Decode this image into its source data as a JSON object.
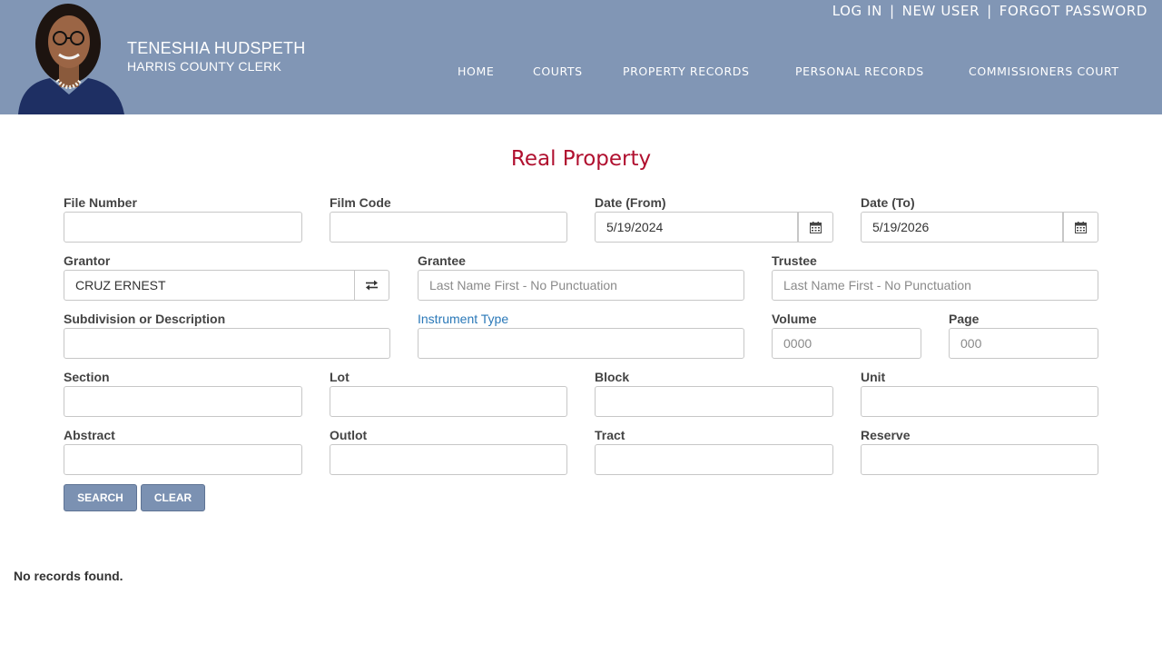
{
  "header": {
    "clerk_name": "TENESHIA HUDSPETH",
    "clerk_title": "HARRIS COUNTY CLERK",
    "top_links": [
      "LOG IN",
      "NEW USER",
      "FORGOT PASSWORD"
    ],
    "separator": "|",
    "nav": [
      "HOME",
      "COURTS",
      "PROPERTY RECORDS",
      "PERSONAL RECORDS",
      "COMMISSIONERS COURT"
    ],
    "colors": {
      "header_bg": "#8196b5",
      "title": "#b0102f",
      "button": "#7b91b2",
      "link_label": "#2a78b8"
    }
  },
  "page_title": "Real Property",
  "form": {
    "file_number": {
      "label": "File Number",
      "value": "",
      "placeholder": ""
    },
    "film_code": {
      "label": "Film Code",
      "value": "",
      "placeholder": ""
    },
    "date_from": {
      "label": "Date (From)",
      "value": "5/19/2024",
      "icon": "calendar-icon"
    },
    "date_to": {
      "label": "Date (To)",
      "value": "5/19/2026",
      "icon": "calendar-icon"
    },
    "grantor": {
      "label": "Grantor",
      "value": "CRUZ ERNEST",
      "icon": "swap-icon"
    },
    "grantee": {
      "label": "Grantee",
      "value": "",
      "placeholder": "Last Name First - No Punctuation"
    },
    "trustee": {
      "label": "Trustee",
      "value": "",
      "placeholder": "Last Name First - No Punctuation"
    },
    "subdivision": {
      "label": "Subdivision or Description",
      "value": ""
    },
    "instrument_type": {
      "label": "Instrument Type",
      "value": ""
    },
    "volume": {
      "label": "Volume",
      "value": "",
      "placeholder": "0000"
    },
    "page": {
      "label": "Page",
      "value": "",
      "placeholder": "000"
    },
    "section": {
      "label": "Section",
      "value": ""
    },
    "lot": {
      "label": "Lot",
      "value": ""
    },
    "block": {
      "label": "Block",
      "value": ""
    },
    "unit": {
      "label": "Unit",
      "value": ""
    },
    "abstract": {
      "label": "Abstract",
      "value": ""
    },
    "outlot": {
      "label": "Outlot",
      "value": ""
    },
    "tract": {
      "label": "Tract",
      "value": ""
    },
    "reserve": {
      "label": "Reserve",
      "value": ""
    },
    "search_label": "SEARCH",
    "clear_label": "CLEAR"
  },
  "results_text": "No records found."
}
